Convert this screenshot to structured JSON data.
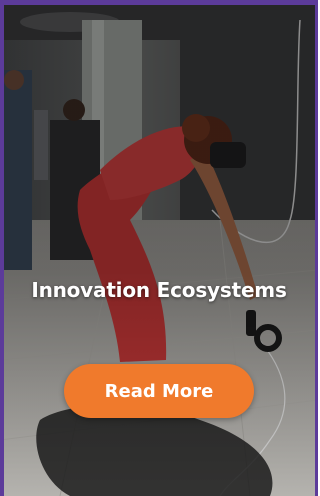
{
  "card": {
    "title": "Innovation Ecosystems",
    "button_label": "Read More",
    "accent_color": "#f07a2c",
    "border_color": "#5c3b9a"
  },
  "image": {
    "subject": "photo",
    "accent_colors": [
      "#d23a3a",
      "#c8c8c4"
    ]
  }
}
